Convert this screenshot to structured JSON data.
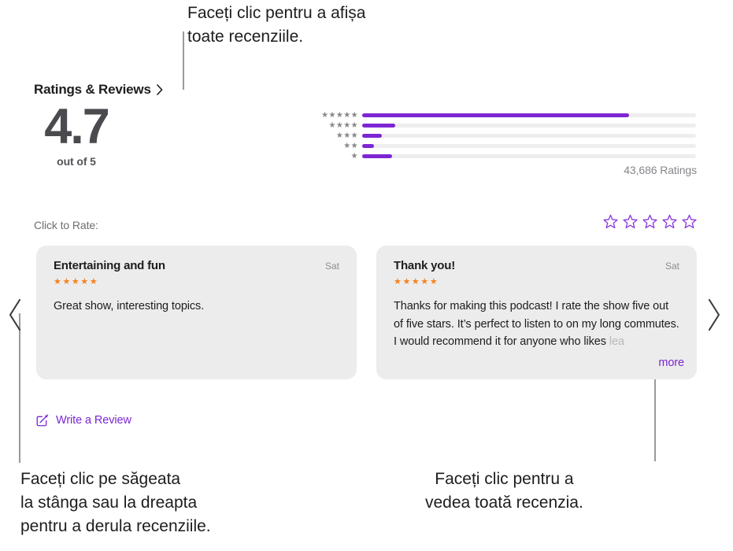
{
  "callouts": {
    "top": "Faceți clic pentru a afișa\ntoate recenziile.",
    "bottom_left": "Faceți clic pe săgeata\nla stânga sau la dreapta\npentru a derula recenziile.",
    "bottom_right": "Faceți clic pentru a\nvedea toată recenzia."
  },
  "header": {
    "title": "Ratings & Reviews",
    "disclosure_icon": "chevron-right-icon"
  },
  "score": {
    "value": "4.7",
    "out_of": "out of 5"
  },
  "histogram": {
    "rows": [
      {
        "stars": "★★★★★",
        "star_count": 5,
        "percent": 80
      },
      {
        "stars": "★★★★",
        "star_count": 4,
        "percent": 10
      },
      {
        "stars": "★★★",
        "star_count": 3,
        "percent": 6
      },
      {
        "stars": "★★",
        "star_count": 2,
        "percent": 3.5
      },
      {
        "stars": "★",
        "star_count": 1,
        "percent": 9
      }
    ],
    "total_label": "43,686 Ratings"
  },
  "rate": {
    "label": "Click to Rate:",
    "stars": [
      "☆",
      "☆",
      "☆",
      "☆",
      "☆"
    ],
    "star_icon": "star-outline-icon"
  },
  "reviews": [
    {
      "title": "Entertaining and fun",
      "date": "Sat",
      "stars": "★★★★★",
      "body": "Great show, interesting topics.",
      "body_fade": "",
      "more_label": ""
    },
    {
      "title": "Thank you!",
      "date": "Sat",
      "stars": "★★★★★",
      "body": "Thanks for making this podcast! I rate the show five out of five stars. It’s perfect to listen to on my long commutes. I would recommend it for anyone who likes ",
      "body_fade": "lea",
      "more_label": "more"
    }
  ],
  "write_review": {
    "label": "Write a Review",
    "icon": "compose-icon"
  },
  "carousel": {
    "prev_icon": "chevron-left-icon",
    "next_icon": "chevron-right-icon"
  },
  "colors": {
    "purple": "#7d26d4",
    "orange": "#f58220",
    "card_bg": "#ececec",
    "track": "#eeeeee"
  }
}
